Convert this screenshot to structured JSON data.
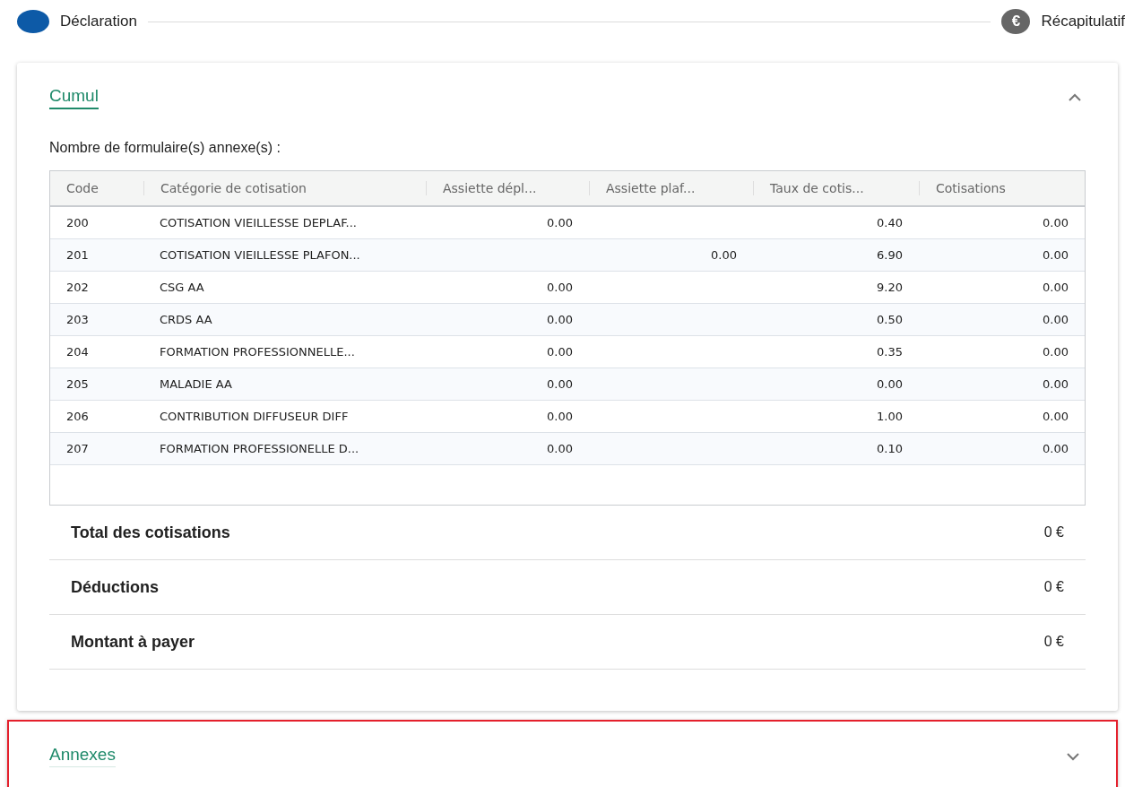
{
  "stepper": {
    "steps": [
      {
        "label": "Déclaration",
        "selected": true,
        "kind": "dot"
      },
      {
        "label": "Récapitulatif",
        "selected": false,
        "kind": "glyph",
        "glyph": "€"
      }
    ]
  },
  "cumul": {
    "title": "Cumul",
    "expanded": true,
    "count_label": "Nombre de formulaire(s) annexe(s) :",
    "table": {
      "columns": [
        {
          "label": "Code",
          "kind": "text"
        },
        {
          "label": "Catégorie de cotisation",
          "kind": "text"
        },
        {
          "label": "Assiette dépl...",
          "kind": "number"
        },
        {
          "label": "Assiette plaf...",
          "kind": "number"
        },
        {
          "label": "Taux de cotis...",
          "kind": "number"
        },
        {
          "label": "Cotisations",
          "kind": "number"
        }
      ],
      "rows": [
        [
          "200",
          "COTISATION VIEILLESSE DEPLAF...",
          "0.00",
          "",
          "0.40",
          "0.00"
        ],
        [
          "201",
          "COTISATION VIEILLESSE PLAFON...",
          "",
          "0.00",
          "6.90",
          "0.00"
        ],
        [
          "202",
          "CSG AA",
          "0.00",
          "",
          "9.20",
          "0.00"
        ],
        [
          "203",
          "CRDS AA",
          "0.00",
          "",
          "0.50",
          "0.00"
        ],
        [
          "204",
          "FORMATION PROFESSIONNELLE...",
          "0.00",
          "",
          "0.35",
          "0.00"
        ],
        [
          "205",
          "MALADIE AA",
          "0.00",
          "",
          "0.00",
          "0.00"
        ],
        [
          "206",
          "CONTRIBUTION DIFFUSEUR DIFF",
          "0.00",
          "",
          "1.00",
          "0.00"
        ],
        [
          "207",
          "FORMATION PROFESSIONELLE D...",
          "0.00",
          "",
          "0.10",
          "0.00"
        ]
      ]
    },
    "totals": [
      {
        "label": "Total des cotisations",
        "value": "0 €"
      },
      {
        "label": "Déductions",
        "value": "0 €"
      },
      {
        "label": "Montant à payer",
        "value": "0 €"
      }
    ]
  },
  "annexes": {
    "title": "Annexes",
    "expanded": false,
    "highlighted": true
  }
}
